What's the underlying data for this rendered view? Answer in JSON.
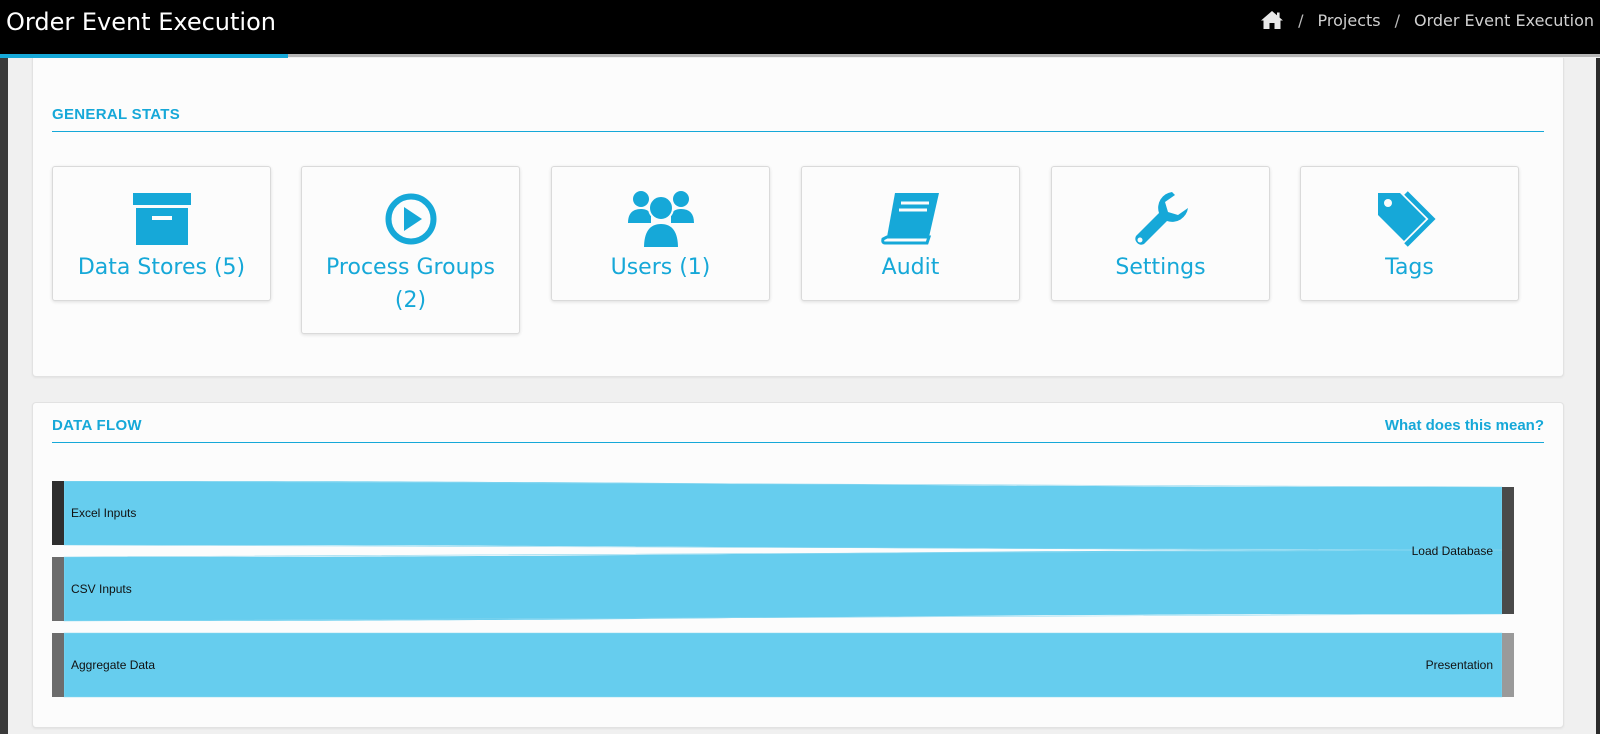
{
  "header": {
    "title": "Order Event Execution",
    "breadcrumb": [
      "Projects",
      "Order Event Execution"
    ]
  },
  "general_stats": {
    "heading": "GENERAL STATS",
    "tiles": [
      {
        "label": "Data Stores (5)",
        "icon": "archive-box-icon"
      },
      {
        "label": "Process Groups (2)",
        "icon": "play-circle-icon"
      },
      {
        "label": "Users (1)",
        "icon": "users-group-icon"
      },
      {
        "label": "Audit",
        "icon": "book-icon"
      },
      {
        "label": "Settings",
        "icon": "wrench-icon"
      },
      {
        "label": "Tags",
        "icon": "tags-icon"
      }
    ]
  },
  "data_flow": {
    "heading": "DATA FLOW",
    "help_link": "What does this mean?",
    "sources": [
      "Excel Inputs",
      "CSV Inputs",
      "Aggregate Data"
    ],
    "targets": [
      "Load Database",
      "Presentation"
    ]
  },
  "colors": {
    "accent": "#16a8d8",
    "flow_fill": "#66cdee",
    "node_dark": "#2e2e2e",
    "node_mid": "#6c6c6c",
    "node_light": "#9a9a9a"
  }
}
